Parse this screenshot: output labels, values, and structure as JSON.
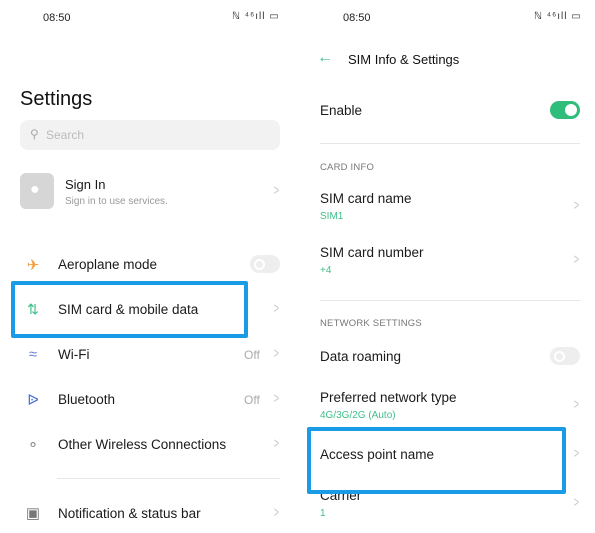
{
  "status_bar": {
    "time": "08:50",
    "icons": "ℕ ⁴⁶ıll ▭"
  },
  "left": {
    "title": "Settings",
    "search_placeholder": "Search",
    "account": {
      "title": "Sign In",
      "subtitle": "Sign in to use services."
    },
    "items": [
      {
        "label": "Aeroplane mode",
        "icon": "airplane-icon",
        "control": "toggle",
        "on": false
      },
      {
        "label": "SIM card & mobile data",
        "icon": "mobile-data-icon",
        "highlighted": true
      },
      {
        "label": "Wi-Fi",
        "icon": "wifi-icon",
        "value": "Off"
      },
      {
        "label": "Bluetooth",
        "icon": "bluetooth-icon",
        "value": "Off"
      },
      {
        "label": "Other Wireless Connections",
        "icon": "connections-icon"
      },
      {
        "label": "Notification & status bar",
        "icon": "notification-icon"
      }
    ]
  },
  "right": {
    "title": "SIM Info & Settings",
    "enable": {
      "label": "Enable",
      "on": true
    },
    "card_info_header": "CARD INFO",
    "sim_name": {
      "label": "SIM card name",
      "value": "SIM1"
    },
    "sim_number": {
      "label": "SIM card number",
      "value": "+4"
    },
    "network_header": "NETWORK SETTINGS",
    "data_roaming": {
      "label": "Data roaming",
      "on": false
    },
    "preferred": {
      "label": "Preferred network type",
      "value": "4G/3G/2G (Auto)"
    },
    "apn": {
      "label": "Access point name",
      "highlighted": true
    },
    "carrier": {
      "label": "Carrier",
      "value": "1"
    }
  },
  "colors": {
    "accent": "#2ebd7a",
    "highlight": "#1a9be6"
  }
}
